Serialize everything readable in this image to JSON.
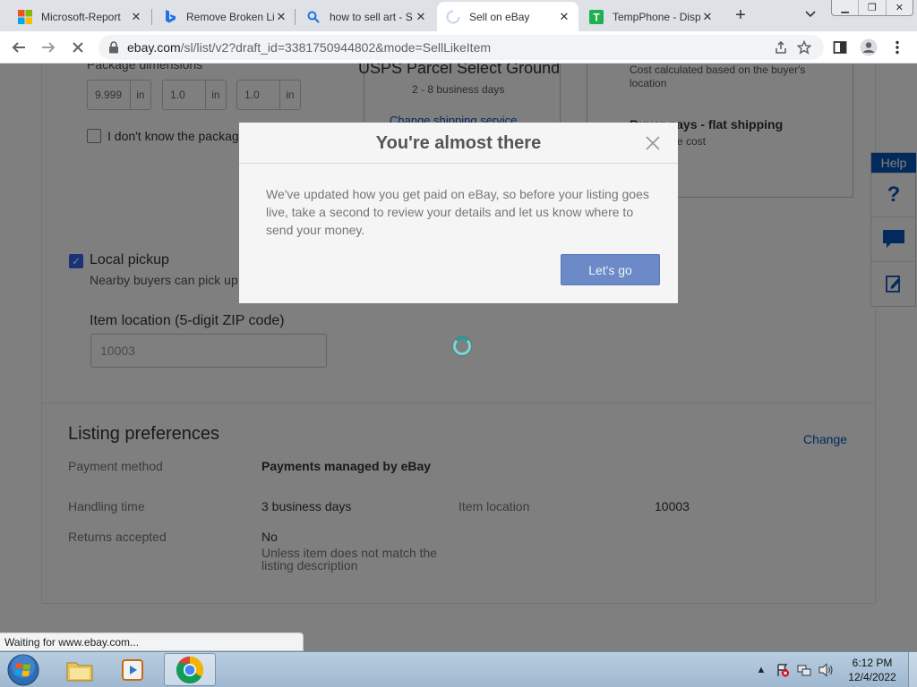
{
  "browser": {
    "tabs": [
      {
        "title": "Microsoft-Report",
        "icon": "microsoft-logo-icon"
      },
      {
        "title": "Remove Broken Li",
        "icon": "bing-icon"
      },
      {
        "title": "how to sell art - S",
        "icon": "search-icon"
      },
      {
        "title": "Sell on eBay",
        "icon": "loading-icon",
        "active": true
      },
      {
        "title": "TempPhone - Disp",
        "icon": "tempphone-icon"
      }
    ],
    "url_domain": "ebay.com",
    "url_rest": "/sl/list/v2?draft_id=3381750944802&mode=SellLikeItem",
    "status_text": "Waiting for www.ebay.com..."
  },
  "shipping": {
    "package_dimensions_label": "Package dimensions",
    "dims": [
      {
        "value": "9.999",
        "unit": "in"
      },
      {
        "value": "1.0",
        "unit": "in"
      },
      {
        "value": "1.0",
        "unit": "in"
      }
    ],
    "dont_know_label": "I don't know the package",
    "service_name": "USPS Parcel Select Ground",
    "service_days": "2 - 8 business days",
    "change_service": "Change shipping service",
    "cost_note": "Cost calculated based on the buyer's location",
    "buyer_pays_title": "Buyer pays - flat shipping",
    "buyer_pays_sub": "You set the cost",
    "local_pickup_label": "Local pickup",
    "local_pickup_sub": "Nearby buyers can pick up",
    "item_location_label": "Item location (5-digit ZIP code)",
    "zip_value": "10003"
  },
  "listing_preferences": {
    "title": "Listing preferences",
    "change": "Change",
    "payment_method_label": "Payment method",
    "payment_method_value": "Payments managed by eBay",
    "handling_time_label": "Handling time",
    "handling_time_value": "3 business days",
    "item_location_label": "Item location",
    "item_location_value": "10003",
    "returns_label": "Returns accepted",
    "returns_value": "No",
    "returns_note": "Unless item does not match the listing description"
  },
  "help": {
    "tab_label": "Help"
  },
  "modal": {
    "title": "You're almost there",
    "body": "We've updated how you get paid on eBay, so before your listing goes live, take a second to review your details and let us know where to send your money.",
    "button": "Let's go"
  },
  "taskbar": {
    "time": "6:12 PM",
    "date": "12/4/2022"
  },
  "colors": {
    "ebay_blue": "#0654ba",
    "button_blue": "#6b8ac7",
    "overlay": "rgba(0,0,0,0.5)"
  }
}
